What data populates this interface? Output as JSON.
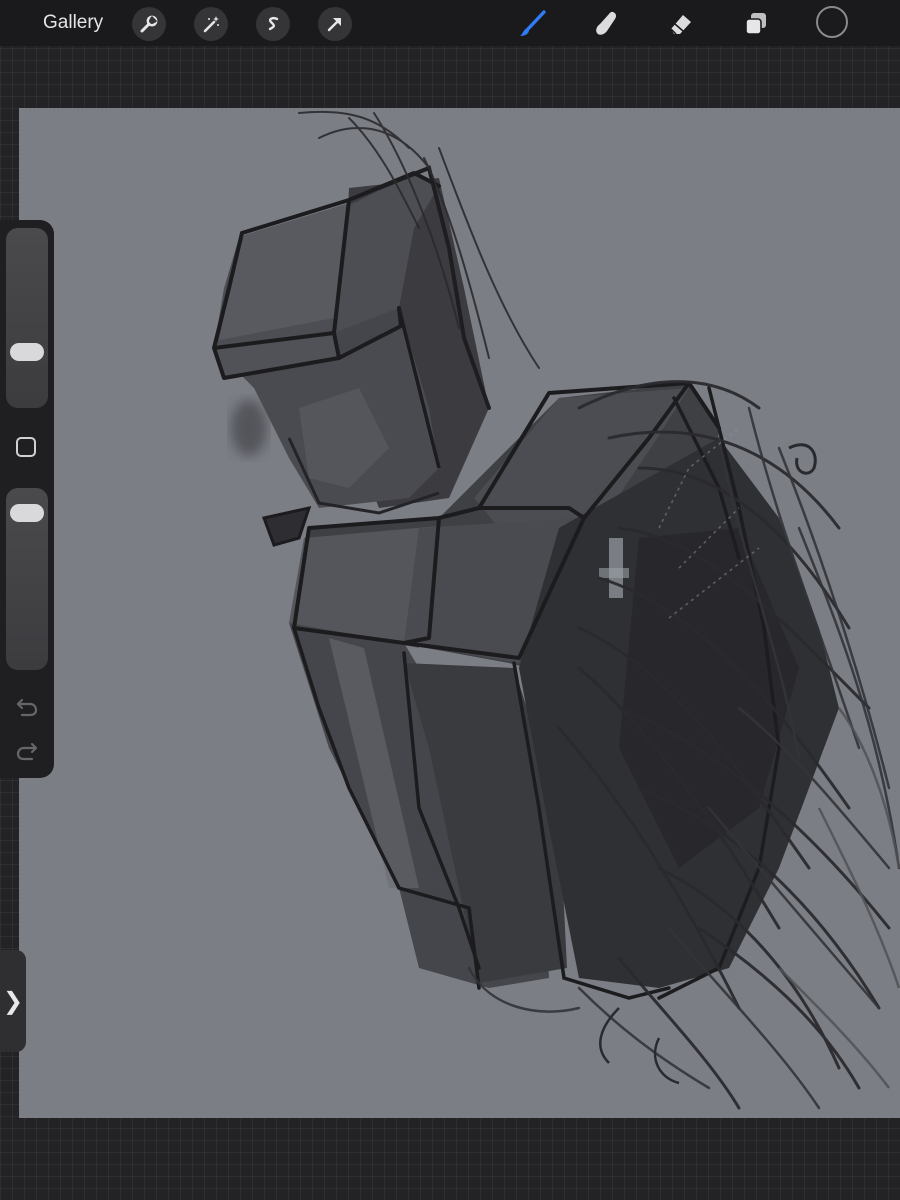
{
  "toolbar": {
    "gallery_label": "Gallery",
    "left_tools": [
      {
        "name": "actions",
        "icon": "wrench-icon"
      },
      {
        "name": "adjustments",
        "icon": "magic-wand-icon"
      },
      {
        "name": "selection",
        "icon": "selection-s-icon"
      },
      {
        "name": "transform",
        "icon": "arrow-cursor-icon"
      }
    ],
    "right_tools": [
      {
        "name": "brush",
        "icon": "brush-icon",
        "active": true
      },
      {
        "name": "smudge",
        "icon": "smudge-finger-icon",
        "active": false
      },
      {
        "name": "eraser",
        "icon": "eraser-icon",
        "active": false
      },
      {
        "name": "layers",
        "icon": "layers-icon",
        "active": false
      }
    ],
    "current_color": "#1b1b1d",
    "accent_color": "#2f7cf6"
  },
  "sidebar": {
    "brush_size_level": 0.28,
    "opacity_level": 0.92,
    "modify_button_icon": "square-icon",
    "undo_icon": "undo-icon",
    "redo_icon": "redo-icon"
  },
  "canvas": {
    "background_color": "#7b7e85"
  },
  "panel_tab": {
    "glyph": "❯"
  }
}
